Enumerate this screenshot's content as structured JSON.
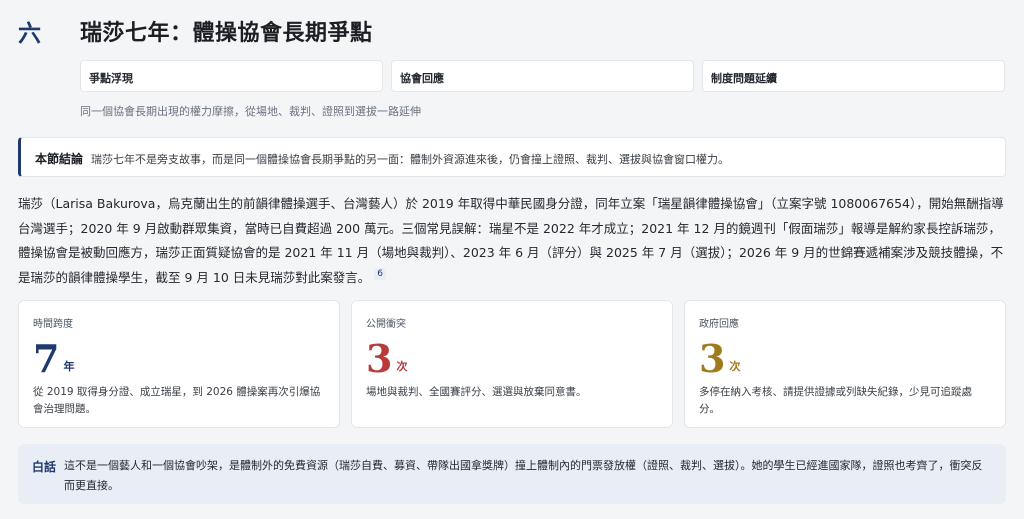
{
  "section": {
    "number": "六",
    "title": "瑞莎七年：體操協會長期爭點"
  },
  "tags": [
    "爭點浮現",
    "協會回應",
    "制度問題延續"
  ],
  "subtitle": "同一個協會長期出現的權力摩擦，從場地、裁判、證照到選拔一路延伸",
  "conclusion": {
    "label": "本節結論",
    "text": "瑞莎七年不是旁支故事，而是同一個體操協會長期爭點的另一面：體制外資源進來後，仍會撞上證照、裁判、選拔與協會窗口權力。"
  },
  "body": {
    "text": "瑞莎（Larisa Bakurova，烏克蘭出生的前韻律體操選手、台灣藝人）於 2019 年取得中華民國身分證，同年立案「瑞星韻律體操協會」（立案字號 1080067654），開始無酬指導台灣選手；2020 年 9 月啟動群眾集資，當時已自費超過 200 萬元。三個常見誤解：瑞星不是 2022 年才成立；2021 年 12 月的鏡週刊「假面瑞莎」報導是解約家長控訴瑞莎，體操協會是被動回應方，瑞莎正面質疑協會的是 2021 年 11 月（場地與裁判）、2023 年 6 月（評分）與 2025 年 7 月（選拔）；2026 年 9 月的世錦賽遞補案涉及競技體操，不是瑞莎的韻律體操學生，截至 9 月 10 日未見瑞莎對此案發言。",
    "footnote": "6"
  },
  "cards": [
    {
      "label": "時間跨度",
      "number": "7",
      "unit": "年",
      "color": "#1e3a6e",
      "desc": "從 2019 取得身分證、成立瑞星，到 2026 體操案再次引爆協會治理問題。"
    },
    {
      "label": "公開衝突",
      "number": "3",
      "unit": "次",
      "color": "#b83a3a",
      "desc": "場地與裁判、全國賽評分、選選與放棄同意書。"
    },
    {
      "label": "政府回應",
      "number": "3",
      "unit": "次",
      "color": "#a07a1c",
      "desc": "多停在納入考核、請提供證據或列缺失紀錄，少見可追蹤處分。"
    }
  ],
  "plain": {
    "label": "白話",
    "text": "這不是一個藝人和一個協會吵架，是體制外的免費資源（瑞莎自費、募資、帶隊出國拿獎牌）撞上體制內的門票發放權（證照、裁判、選拔）。她的學生已經進國家隊，證照也考齊了，衝突反而更直接。"
  }
}
